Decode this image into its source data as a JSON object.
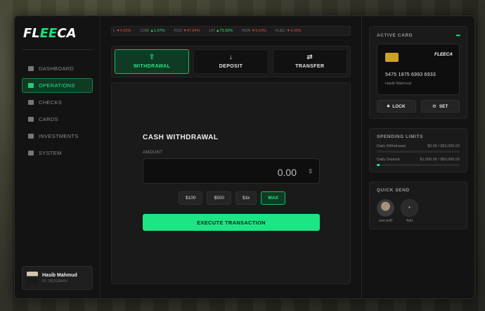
{
  "brand": {
    "logo_a": "FL",
    "logo_b": "EE",
    "logo_c": "CA"
  },
  "sidebar": {
    "items": [
      {
        "label": "DASHBOARD",
        "icon": "layers-icon",
        "active": false
      },
      {
        "label": "OPERATIONS",
        "icon": "money-icon",
        "active": true
      },
      {
        "label": "CHECKS",
        "icon": "checks-icon",
        "active": false
      },
      {
        "label": "CARDS",
        "icon": "card-icon",
        "active": false
      },
      {
        "label": "INVESTMENTS",
        "icon": "chart-icon",
        "active": false
      },
      {
        "label": "SYSTEM",
        "icon": "sliders-icon",
        "active": false
      }
    ],
    "user": {
      "name": "Hasib Mahmud",
      "id": "ID: 2BJG8A6H"
    }
  },
  "ticker": [
    {
      "sym": "L",
      "val": "▼4.00%",
      "dir": "down"
    },
    {
      "sym": "LOW",
      "val": "▲1.07%",
      "dir": "up"
    },
    {
      "sym": "FCD",
      "val": "▼67.84%",
      "dir": "down"
    },
    {
      "sym": "LFI",
      "val": "▲73.92%",
      "dir": "up"
    },
    {
      "sym": "RON",
      "val": "▼9.34%",
      "dir": "down"
    },
    {
      "sym": "FLEC",
      "val": "▼4.00%",
      "dir": "down"
    }
  ],
  "tabs": [
    {
      "label": "WITHDRAWAL",
      "icon": "upload-icon",
      "glyph": "⇪"
    },
    {
      "label": "DEPOSIT",
      "icon": "arrow-down-icon",
      "glyph": "↓"
    },
    {
      "label": "TRANSFER",
      "icon": "swap-icon",
      "glyph": "⇄"
    }
  ],
  "withdraw": {
    "title": "CASH WITHDRAWAL",
    "amount_label": "AMOUNT",
    "amount_value": "0.00",
    "currency": "$",
    "quick": [
      "$100",
      "$500",
      "$1k",
      "MAX"
    ],
    "execute": "EXECUTE TRANSACTION"
  },
  "active_card": {
    "title": "ACTIVE CARD",
    "menu": "•••",
    "brand": "FLEECA",
    "number": "5475 1875 6993 6933",
    "holder": "Hasib Mahmud",
    "lock": "LOCK",
    "set": "SET"
  },
  "limits": {
    "title": "SPENDING LIMITS",
    "rows": [
      {
        "label": "Daily Withdrawal",
        "value": "$0.00 / $50,000.00",
        "fraction": 0.0
      },
      {
        "label": "Daily Deposit",
        "value": "$1,600.00 / $50,000.00",
        "fraction": 0.032
      }
    ]
  },
  "quick_send": {
    "title": "QUICK SEND",
    "contacts": [
      {
        "name": "asd asdf"
      },
      {
        "name": "Add",
        "glyph": "+"
      }
    ]
  }
}
